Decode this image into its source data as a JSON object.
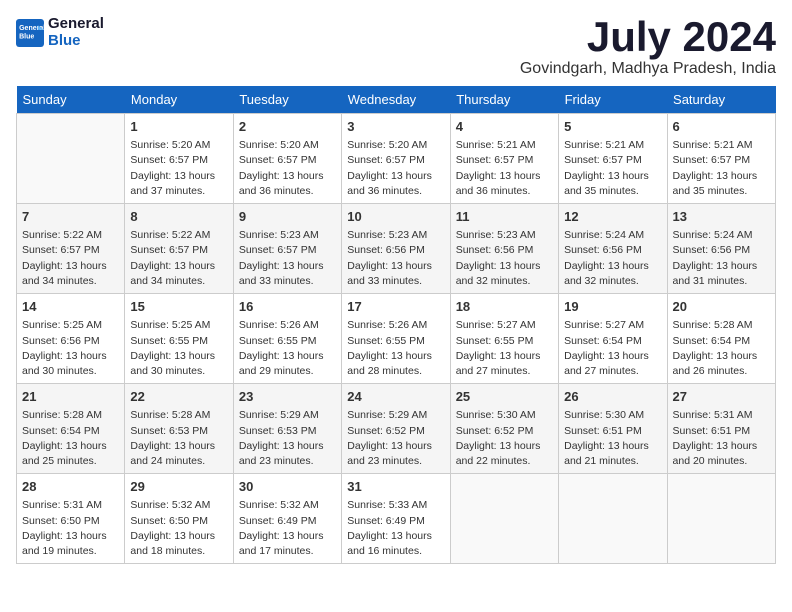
{
  "header": {
    "logo_line1": "General",
    "logo_line2": "Blue",
    "month_year": "July 2024",
    "location": "Govindgarh, Madhya Pradesh, India"
  },
  "days_of_week": [
    "Sunday",
    "Monday",
    "Tuesday",
    "Wednesday",
    "Thursday",
    "Friday",
    "Saturday"
  ],
  "weeks": [
    [
      {
        "num": "",
        "info": ""
      },
      {
        "num": "1",
        "info": "Sunrise: 5:20 AM\nSunset: 6:57 PM\nDaylight: 13 hours\nand 37 minutes."
      },
      {
        "num": "2",
        "info": "Sunrise: 5:20 AM\nSunset: 6:57 PM\nDaylight: 13 hours\nand 36 minutes."
      },
      {
        "num": "3",
        "info": "Sunrise: 5:20 AM\nSunset: 6:57 PM\nDaylight: 13 hours\nand 36 minutes."
      },
      {
        "num": "4",
        "info": "Sunrise: 5:21 AM\nSunset: 6:57 PM\nDaylight: 13 hours\nand 36 minutes."
      },
      {
        "num": "5",
        "info": "Sunrise: 5:21 AM\nSunset: 6:57 PM\nDaylight: 13 hours\nand 35 minutes."
      },
      {
        "num": "6",
        "info": "Sunrise: 5:21 AM\nSunset: 6:57 PM\nDaylight: 13 hours\nand 35 minutes."
      }
    ],
    [
      {
        "num": "7",
        "info": "Sunrise: 5:22 AM\nSunset: 6:57 PM\nDaylight: 13 hours\nand 34 minutes."
      },
      {
        "num": "8",
        "info": "Sunrise: 5:22 AM\nSunset: 6:57 PM\nDaylight: 13 hours\nand 34 minutes."
      },
      {
        "num": "9",
        "info": "Sunrise: 5:23 AM\nSunset: 6:57 PM\nDaylight: 13 hours\nand 33 minutes."
      },
      {
        "num": "10",
        "info": "Sunrise: 5:23 AM\nSunset: 6:56 PM\nDaylight: 13 hours\nand 33 minutes."
      },
      {
        "num": "11",
        "info": "Sunrise: 5:23 AM\nSunset: 6:56 PM\nDaylight: 13 hours\nand 32 minutes."
      },
      {
        "num": "12",
        "info": "Sunrise: 5:24 AM\nSunset: 6:56 PM\nDaylight: 13 hours\nand 32 minutes."
      },
      {
        "num": "13",
        "info": "Sunrise: 5:24 AM\nSunset: 6:56 PM\nDaylight: 13 hours\nand 31 minutes."
      }
    ],
    [
      {
        "num": "14",
        "info": "Sunrise: 5:25 AM\nSunset: 6:56 PM\nDaylight: 13 hours\nand 30 minutes."
      },
      {
        "num": "15",
        "info": "Sunrise: 5:25 AM\nSunset: 6:55 PM\nDaylight: 13 hours\nand 30 minutes."
      },
      {
        "num": "16",
        "info": "Sunrise: 5:26 AM\nSunset: 6:55 PM\nDaylight: 13 hours\nand 29 minutes."
      },
      {
        "num": "17",
        "info": "Sunrise: 5:26 AM\nSunset: 6:55 PM\nDaylight: 13 hours\nand 28 minutes."
      },
      {
        "num": "18",
        "info": "Sunrise: 5:27 AM\nSunset: 6:55 PM\nDaylight: 13 hours\nand 27 minutes."
      },
      {
        "num": "19",
        "info": "Sunrise: 5:27 AM\nSunset: 6:54 PM\nDaylight: 13 hours\nand 27 minutes."
      },
      {
        "num": "20",
        "info": "Sunrise: 5:28 AM\nSunset: 6:54 PM\nDaylight: 13 hours\nand 26 minutes."
      }
    ],
    [
      {
        "num": "21",
        "info": "Sunrise: 5:28 AM\nSunset: 6:54 PM\nDaylight: 13 hours\nand 25 minutes."
      },
      {
        "num": "22",
        "info": "Sunrise: 5:28 AM\nSunset: 6:53 PM\nDaylight: 13 hours\nand 24 minutes."
      },
      {
        "num": "23",
        "info": "Sunrise: 5:29 AM\nSunset: 6:53 PM\nDaylight: 13 hours\nand 23 minutes."
      },
      {
        "num": "24",
        "info": "Sunrise: 5:29 AM\nSunset: 6:52 PM\nDaylight: 13 hours\nand 23 minutes."
      },
      {
        "num": "25",
        "info": "Sunrise: 5:30 AM\nSunset: 6:52 PM\nDaylight: 13 hours\nand 22 minutes."
      },
      {
        "num": "26",
        "info": "Sunrise: 5:30 AM\nSunset: 6:51 PM\nDaylight: 13 hours\nand 21 minutes."
      },
      {
        "num": "27",
        "info": "Sunrise: 5:31 AM\nSunset: 6:51 PM\nDaylight: 13 hours\nand 20 minutes."
      }
    ],
    [
      {
        "num": "28",
        "info": "Sunrise: 5:31 AM\nSunset: 6:50 PM\nDaylight: 13 hours\nand 19 minutes."
      },
      {
        "num": "29",
        "info": "Sunrise: 5:32 AM\nSunset: 6:50 PM\nDaylight: 13 hours\nand 18 minutes."
      },
      {
        "num": "30",
        "info": "Sunrise: 5:32 AM\nSunset: 6:49 PM\nDaylight: 13 hours\nand 17 minutes."
      },
      {
        "num": "31",
        "info": "Sunrise: 5:33 AM\nSunset: 6:49 PM\nDaylight: 13 hours\nand 16 minutes."
      },
      {
        "num": "",
        "info": ""
      },
      {
        "num": "",
        "info": ""
      },
      {
        "num": "",
        "info": ""
      }
    ]
  ]
}
